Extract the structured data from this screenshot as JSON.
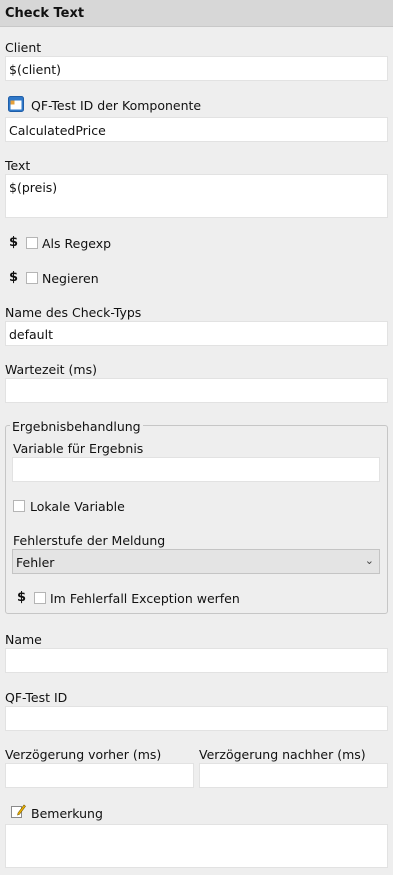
{
  "header": {
    "title": "Check Text"
  },
  "client": {
    "label": "Client",
    "value": "$(client)"
  },
  "component": {
    "label": "QF-Test ID der Komponente",
    "value": "CalculatedPrice",
    "icon": "component-window-icon"
  },
  "text": {
    "label": "Text",
    "value": "$(preis)"
  },
  "regexp": {
    "dollar": "$",
    "label": "Als Regexp",
    "checked": false
  },
  "negate": {
    "dollar": "$",
    "label": "Negieren",
    "checked": false
  },
  "check_type": {
    "label": "Name des Check-Typs",
    "value": "default"
  },
  "wait_time": {
    "label": "Wartezeit (ms)",
    "value": ""
  },
  "result_group": {
    "legend": "Ergebnisbehandlung",
    "variable_label": "Variable für Ergebnis",
    "variable_value": "",
    "local_label": "Lokale Variable",
    "error_level_label": "Fehlerstufe der Meldung",
    "error_level_value": "Fehler",
    "exception_dollar": "$",
    "exception_label": "Im Fehlerfall Exception werfen"
  },
  "name": {
    "label": "Name",
    "value": ""
  },
  "qftest_id": {
    "label": "QF-Test ID",
    "value": ""
  },
  "delay_before": {
    "label": "Verzögerung vorher (ms)",
    "value": ""
  },
  "delay_after": {
    "label": "Verzögerung nachher (ms)",
    "value": ""
  },
  "comment": {
    "label": "Bemerkung",
    "value": "",
    "icon": "note-pencil-icon"
  }
}
